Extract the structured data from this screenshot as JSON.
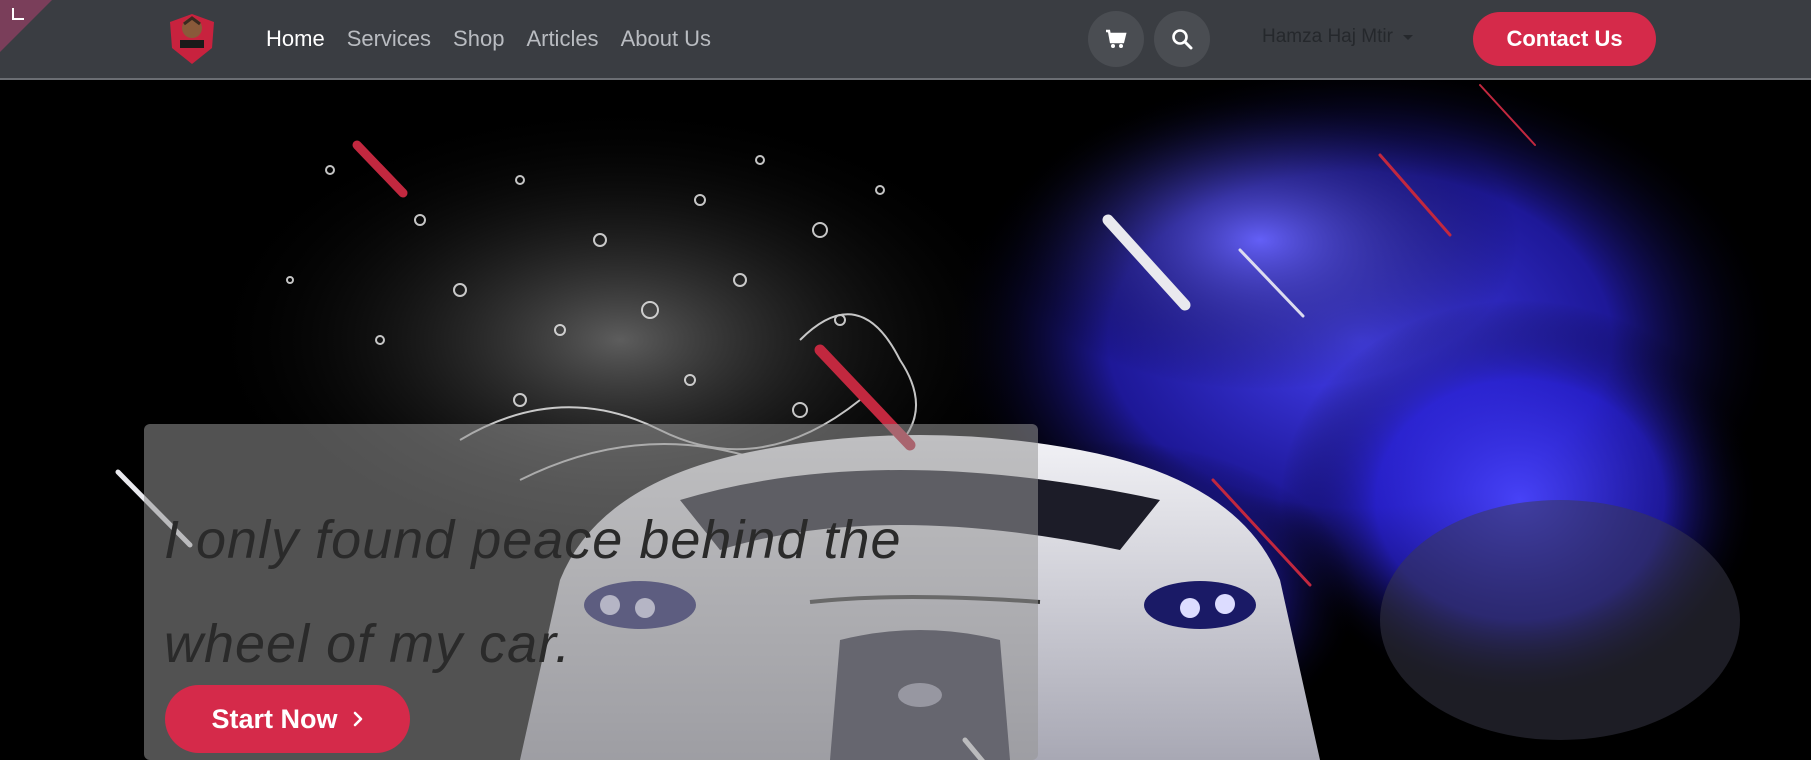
{
  "nav": {
    "links": [
      {
        "label": "Home",
        "active": true
      },
      {
        "label": "Services",
        "active": false
      },
      {
        "label": "Shop",
        "active": false
      },
      {
        "label": "Articles",
        "active": false
      },
      {
        "label": "About Us",
        "active": false
      }
    ],
    "icons": [
      "cart-icon",
      "search-icon"
    ],
    "user_name": "Hamza Haj Mtir",
    "contact_label": "Contact Us"
  },
  "hero": {
    "quote": "I only found peace behind the wheel of my car.",
    "button_label": "Start Now"
  },
  "colors": {
    "accent": "#d52a4a",
    "navbar": "#3a3d42",
    "flame": "#2f2bf0"
  }
}
